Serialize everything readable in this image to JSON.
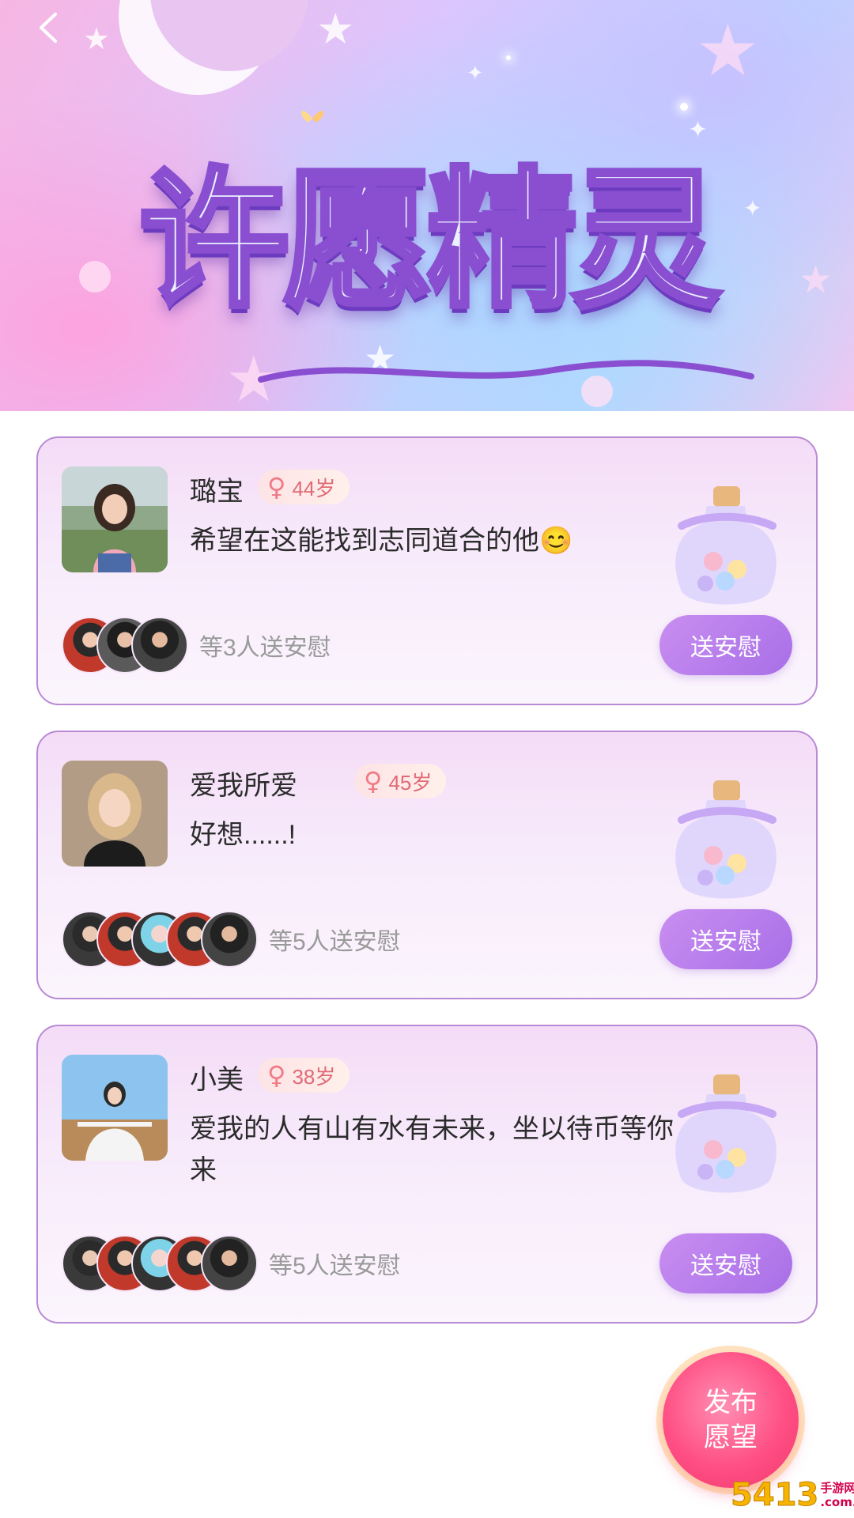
{
  "header": {
    "back_icon": "chevron-left-icon",
    "title": "许愿精灵"
  },
  "wishes": [
    {
      "name": "璐宝",
      "gender_icon": "female-icon",
      "gender_symbol": "♀",
      "age": "44岁",
      "text": "希望在这能找到志同道合的他😊",
      "comfort_count": "等3人送安慰",
      "supporters": 3,
      "button": "送安慰"
    },
    {
      "name": "爱我所爱",
      "gender_icon": "female-icon",
      "gender_symbol": "♀",
      "age": "45岁",
      "text": "好想......!",
      "comfort_count": "等5人送安慰",
      "supporters": 5,
      "button": "送安慰"
    },
    {
      "name": "小美",
      "gender_icon": "female-icon",
      "gender_symbol": "♀",
      "age": "38岁",
      "text": "爱我的人有山有水有未来，坐以待币等你来",
      "comfort_count": "等5人送安慰",
      "supporters": 5,
      "button": "送安慰"
    }
  ],
  "fab": {
    "line1": "发布",
    "line2": "愿望"
  },
  "watermark": {
    "number": "5413",
    "line1": "手游网",
    "line2": ".com.cn"
  },
  "colors": {
    "accent_purple": "#a86fe8",
    "card_border": "#b98ad6",
    "fab_pink": "#ff4f84",
    "age_text": "#e06a76"
  }
}
